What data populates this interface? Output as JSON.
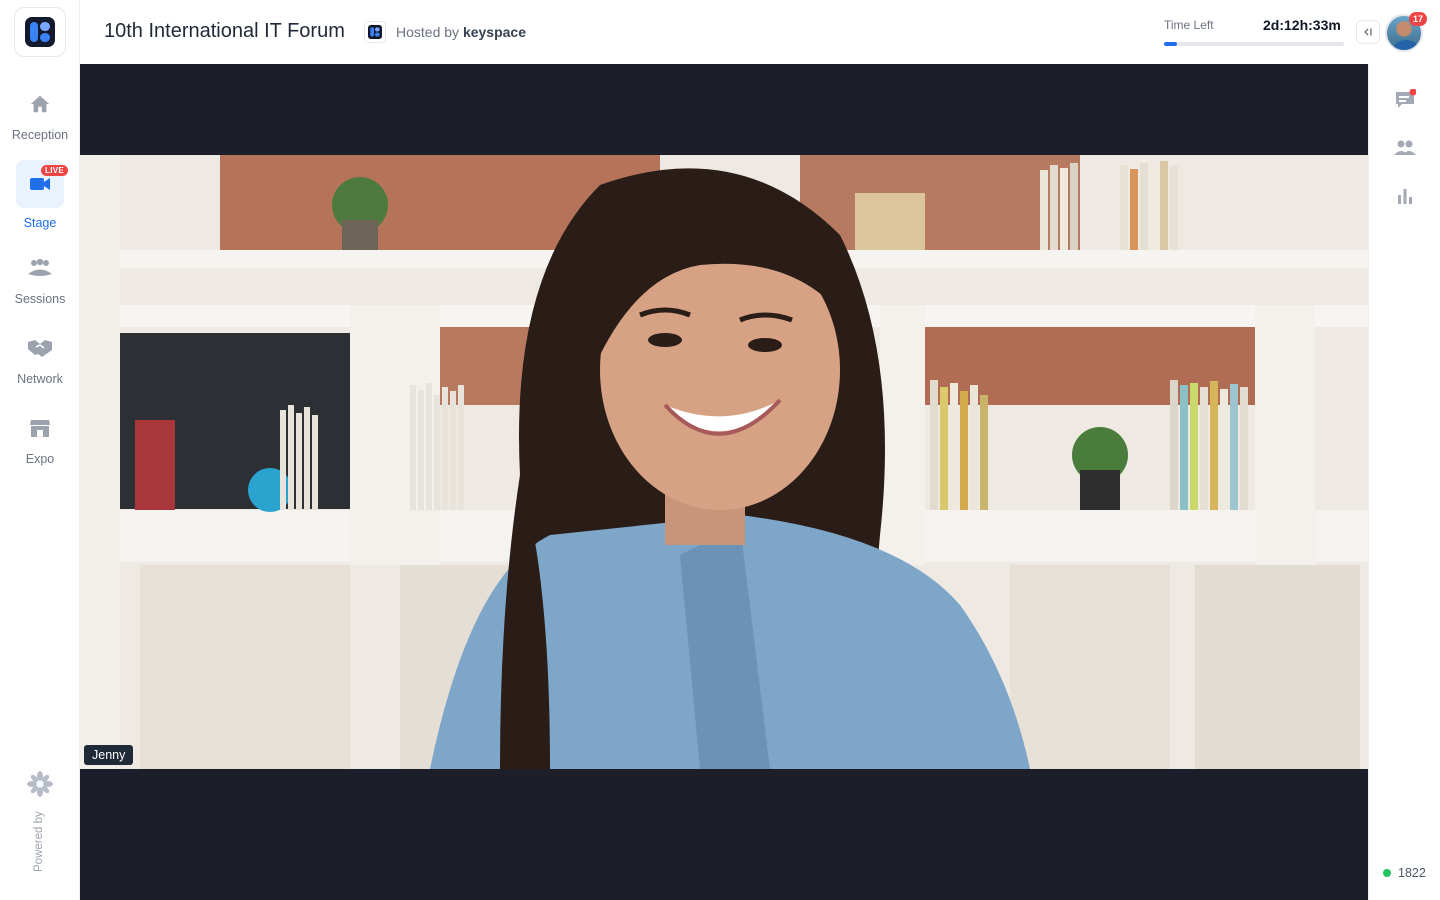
{
  "app": {
    "event_title": "10th International IT Forum",
    "hosted_prefix": "Hosted by",
    "host_name": "keyspace"
  },
  "nav": {
    "items": [
      {
        "label": "Reception",
        "icon": "home-icon"
      },
      {
        "label": "Stage",
        "icon": "video-camera-icon",
        "badge": "LIVE",
        "active": true
      },
      {
        "label": "Sessions",
        "icon": "sessions-icon"
      },
      {
        "label": "Network",
        "icon": "handshake-icon"
      },
      {
        "label": "Expo",
        "icon": "store-icon"
      }
    ],
    "powered_by": "Powered by"
  },
  "timer": {
    "label": "Time Left",
    "value": "2d:12h:33m",
    "progress": 0.07
  },
  "user": {
    "notifications": "17"
  },
  "stage": {
    "speaker_name": "Jenny"
  },
  "right_panel": {
    "icons": [
      "chat-icon",
      "people-icon",
      "bar-chart-icon"
    ],
    "online_count": "1822"
  },
  "colors": {
    "accent": "#1f6feb",
    "live": "#ef4444",
    "stage_bg": "#1c1f29",
    "online": "#22c55e"
  }
}
